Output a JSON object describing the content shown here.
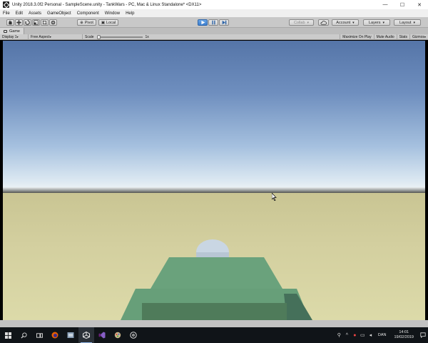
{
  "window": {
    "title": "Unity 2018.3.0f2 Personal - SampleScene.unity - TankWars - PC, Mac & Linux Standalone* <DX11>",
    "minimize": "—",
    "maximize": "☐",
    "close": "✕"
  },
  "menu": [
    "File",
    "Edit",
    "Assets",
    "GameObject",
    "Component",
    "Window",
    "Help"
  ],
  "toolbar": {
    "pivot_label": "Pivot",
    "local_label": "Local",
    "collab_label": "Collab",
    "account_label": "Account",
    "layers_label": "Layers",
    "layout_label": "Layout"
  },
  "game_view": {
    "tab_label": "Game",
    "display_label": "Display 1",
    "aspect_label": "Free Aspect",
    "scale_label": "Scale",
    "scale_value": "1x",
    "maximize_on_play": "Maximize On Play",
    "mute_audio": "Mute Audio",
    "stats": "Stats",
    "gizmos": "Gizmos"
  },
  "taskbar": {
    "language": "DAN",
    "time": "14:01",
    "date": "19/02/2019"
  },
  "colors": {
    "sky_top": "#5575a8",
    "sky_horizon": "#f4f6f6",
    "ground": "#d3cf9f",
    "tank_body": "#6aa27c",
    "tank_front": "#4f7b5a",
    "turret": "#c9d6e3",
    "play_button": "#3d7fcf"
  }
}
